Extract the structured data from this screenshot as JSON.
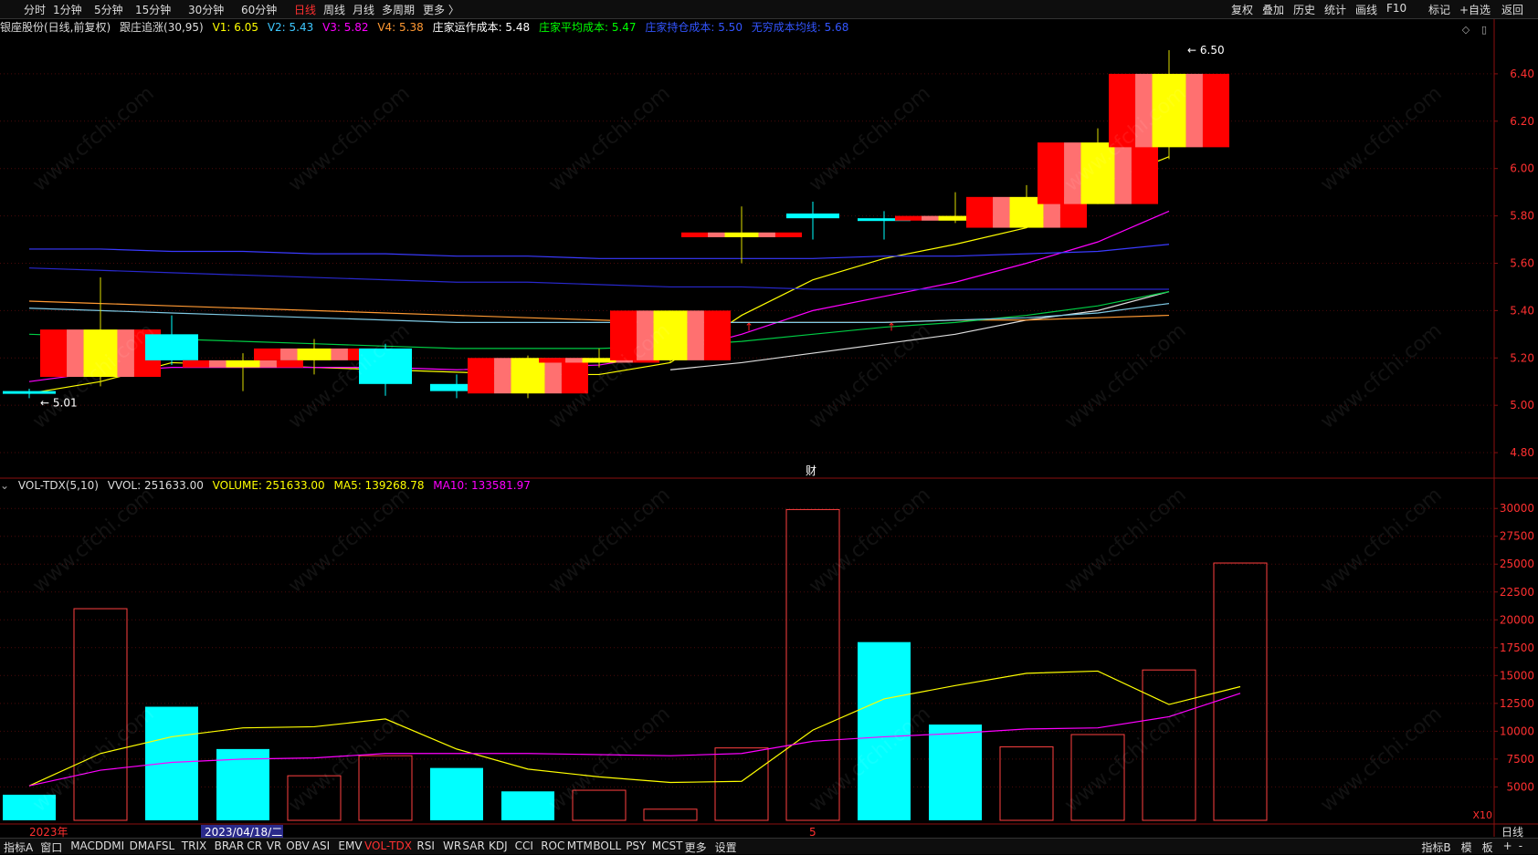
{
  "topbar": {
    "left": [
      {
        "name": "tab-fenshi",
        "label": "分时"
      },
      {
        "name": "tab-1min",
        "label": "1分钟"
      },
      {
        "name": "tab-5min",
        "label": "5分钟"
      },
      {
        "name": "tab-15min",
        "label": "15分钟"
      },
      {
        "name": "tab-30min",
        "label": "30分钟"
      },
      {
        "name": "tab-60min",
        "label": "60分钟"
      },
      {
        "name": "tab-daily",
        "label": "日线",
        "active": true
      },
      {
        "name": "tab-weekly",
        "label": "周线"
      },
      {
        "name": "tab-monthly",
        "label": "月线"
      },
      {
        "name": "tab-multi",
        "label": "多周期"
      },
      {
        "name": "tab-more",
        "label": "更多 〉"
      }
    ],
    "right": [
      {
        "name": "btn-fuquan",
        "label": "复权"
      },
      {
        "name": "btn-diejia",
        "label": "叠加"
      },
      {
        "name": "btn-lishi",
        "label": "历史"
      },
      {
        "name": "btn-tongji",
        "label": "统计"
      },
      {
        "name": "btn-huaxian",
        "label": "画线"
      },
      {
        "name": "btn-f10",
        "label": "F10"
      },
      {
        "name": "btn-biaoji",
        "label": "标记"
      },
      {
        "name": "btn-zixuan",
        "label": "+自选"
      },
      {
        "name": "btn-fanhui",
        "label": "返回"
      }
    ]
  },
  "infobar": {
    "stock": "银座股份(日线,前复权)",
    "indicator": "跟庄追涨(30,95)",
    "v1": "V1: 6.05",
    "v2": "V2: 5.43",
    "v3": "V3: 5.82",
    "v4": "V4: 5.38",
    "op_cost": "庄家运作成本: 5.48",
    "avg_cost": "庄家平均成本: 5.47",
    "hold_cost": "庄家持仓成本: 5.50",
    "mean_cost": "无穷成本均线: 5.68",
    "colors": {
      "stock": "#dddddd",
      "v1": "#ffff00",
      "v2": "#3ec8ff",
      "v3": "#ff00ff",
      "v4": "#ff9933",
      "op": "#ffffff",
      "avg": "#00ff00",
      "hold": "#3355ff",
      "mean": "#3355ff"
    }
  },
  "volinfo": {
    "title": "VOL-TDX(5,10)",
    "vvol": "VVOL: 251633.00",
    "volume": "VOLUME: 251633.00",
    "ma5": "MA5: 139268.78",
    "ma10": "MA10: 133581.97"
  },
  "bottombar": {
    "items": [
      "指标A",
      "窗口",
      "MACD",
      "DMI",
      "DMA",
      "FSL",
      "TRIX",
      "BRAR",
      "CR",
      "VR",
      "OBV",
      "ASI",
      "EMV",
      "VOL-TDX",
      "RSI",
      "WR",
      "SAR",
      "KDJ",
      "CCI",
      "ROC",
      "MTM",
      "BOLL",
      "PSY",
      "MCST",
      "更多",
      "设置"
    ],
    "active": "VOL-TDX",
    "right": [
      "指标B",
      "模",
      "板",
      "+",
      "-"
    ]
  },
  "period_label": "日线",
  "watermark": "www.cfchi.com",
  "chart_data": [
    {
      "type": "candlestick",
      "ylim": [
        4.7,
        6.55
      ],
      "yticks": [
        "6.40",
        "6.20",
        "6.00",
        "5.80",
        "5.60",
        "5.40",
        "5.20",
        "5.00",
        "4.80"
      ],
      "candles": [
        {
          "o": 5.06,
          "h": 5.07,
          "l": 5.03,
          "c": 5.05,
          "color": "cyan"
        },
        {
          "o": 5.12,
          "h": 5.54,
          "l": 5.08,
          "c": 5.32,
          "color": "red"
        },
        {
          "o": 5.3,
          "h": 5.38,
          "l": 5.17,
          "c": 5.19,
          "color": "cyan"
        },
        {
          "o": 5.16,
          "h": 5.22,
          "l": 5.06,
          "c": 5.19,
          "color": "red"
        },
        {
          "o": 5.19,
          "h": 5.28,
          "l": 5.13,
          "c": 5.24,
          "color": "red"
        },
        {
          "o": 5.24,
          "h": 5.26,
          "l": 5.04,
          "c": 5.09,
          "color": "cyan"
        },
        {
          "o": 5.09,
          "h": 5.13,
          "l": 5.03,
          "c": 5.06,
          "color": "cyan"
        },
        {
          "o": 5.05,
          "h": 5.21,
          "l": 5.03,
          "c": 5.2,
          "color": "red"
        },
        {
          "o": 5.18,
          "h": 5.24,
          "l": 5.16,
          "c": 5.2,
          "color": "red"
        },
        {
          "o": 5.19,
          "h": 5.4,
          "l": 5.18,
          "c": 5.4,
          "color": "red"
        },
        {
          "o": 5.71,
          "h": 5.84,
          "l": 5.6,
          "c": 5.73,
          "color": "red"
        },
        {
          "o": 5.81,
          "h": 5.86,
          "l": 5.7,
          "c": 5.79,
          "color": "cyan"
        },
        {
          "o": 5.79,
          "h": 5.82,
          "l": 5.7,
          "c": 5.78,
          "color": "cyan"
        },
        {
          "o": 5.78,
          "h": 5.9,
          "l": 5.77,
          "c": 5.8,
          "color": "red"
        },
        {
          "o": 5.75,
          "h": 5.93,
          "l": 5.75,
          "c": 5.88,
          "color": "red"
        },
        {
          "o": 5.85,
          "h": 6.17,
          "l": 5.85,
          "c": 6.11,
          "color": "red"
        },
        {
          "o": 6.09,
          "h": 6.5,
          "l": 6.04,
          "c": 6.4,
          "color": "red"
        }
      ],
      "labels": [
        {
          "text": "5.01",
          "index": 0,
          "value": 5.01
        },
        {
          "text": "6.50",
          "index": 16,
          "value": 6.5
        }
      ],
      "event_label": "财",
      "series": [
        {
          "name": "V1",
          "color": "#ffff00",
          "values": [
            5.05,
            5.1,
            5.18,
            5.17,
            5.16,
            5.15,
            5.14,
            5.13,
            5.13,
            5.18,
            5.38,
            5.53,
            5.62,
            5.68,
            5.75,
            5.93,
            6.05
          ]
        },
        {
          "name": "V2",
          "color": "#dddddd",
          "values": [
            null,
            null,
            null,
            null,
            null,
            null,
            null,
            null,
            null,
            5.15,
            5.18,
            5.22,
            5.26,
            5.3,
            5.36,
            5.4,
            5.48
          ]
        },
        {
          "name": "V3",
          "color": "#ff00ff",
          "values": [
            5.1,
            5.14,
            5.16,
            5.16,
            5.16,
            5.16,
            5.15,
            5.16,
            5.17,
            5.22,
            5.3,
            5.4,
            5.46,
            5.52,
            5.6,
            5.69,
            5.82
          ]
        },
        {
          "name": "V4",
          "color": "#ff9933",
          "values": [
            5.44,
            5.43,
            5.42,
            5.41,
            5.4,
            5.39,
            5.38,
            5.37,
            5.36,
            5.35,
            5.35,
            5.35,
            5.35,
            5.36,
            5.36,
            5.37,
            5.38
          ]
        },
        {
          "name": "op",
          "color": "#00cc44",
          "values": [
            5.3,
            5.29,
            5.28,
            5.27,
            5.26,
            5.25,
            5.24,
            5.24,
            5.24,
            5.25,
            5.27,
            5.3,
            5.33,
            5.35,
            5.38,
            5.42,
            5.48
          ]
        },
        {
          "name": "avg",
          "color": "#7ec8e3",
          "values": [
            5.41,
            5.4,
            5.39,
            5.38,
            5.37,
            5.36,
            5.35,
            5.35,
            5.35,
            5.35,
            5.35,
            5.35,
            5.35,
            5.36,
            5.37,
            5.39,
            5.43
          ]
        },
        {
          "name": "hold",
          "color": "#3a3aff",
          "values": [
            5.66,
            5.66,
            5.65,
            5.65,
            5.64,
            5.64,
            5.63,
            5.63,
            5.62,
            5.62,
            5.62,
            5.62,
            5.63,
            5.63,
            5.64,
            5.65,
            5.68
          ]
        },
        {
          "name": "mean",
          "color": "#2828cc",
          "values": [
            5.58,
            5.57,
            5.56,
            5.55,
            5.54,
            5.53,
            5.52,
            5.52,
            5.51,
            5.5,
            5.5,
            5.49,
            5.49,
            5.49,
            5.49,
            5.49,
            5.49
          ]
        }
      ]
    },
    {
      "type": "bar",
      "title": "VOL-TDX(5,10)",
      "ylim": [
        2000,
        31000
      ],
      "yticks": [
        "30000",
        "27500",
        "25000",
        "22500",
        "20000",
        "17500",
        "15000",
        "12500",
        "10000",
        "7500",
        "5000"
      ],
      "unit_label": "X10",
      "values": [
        4300,
        21000,
        12200,
        8400,
        6000,
        7800,
        6700,
        4600,
        4700,
        3000,
        8500,
        29900,
        18000,
        10600,
        8600,
        9700,
        15500,
        25100
      ],
      "colors": [
        "cyan",
        "red",
        "cyan",
        "cyan",
        "red",
        "red",
        "cyan",
        "cyan",
        "red",
        "red",
        "red",
        "red",
        "cyan",
        "cyan",
        "red",
        "red",
        "red",
        "red"
      ],
      "series": [
        {
          "name": "MA5",
          "color": "#ffff00",
          "values": [
            5100,
            8000,
            9500,
            10300,
            10400,
            11100,
            8400,
            6600,
            5900,
            5400,
            5500,
            10100,
            12900,
            14100,
            15200,
            15400,
            12400,
            14000
          ]
        },
        {
          "name": "MA10",
          "color": "#ff00ff",
          "values": [
            5100,
            6500,
            7200,
            7500,
            7600,
            8000,
            8000,
            8000,
            7900,
            7800,
            8000,
            9100,
            9500,
            9800,
            10200,
            10300,
            11300,
            13400
          ]
        }
      ],
      "xlabels": [
        "2023年",
        "2023/04/18/二",
        "5"
      ]
    }
  ]
}
